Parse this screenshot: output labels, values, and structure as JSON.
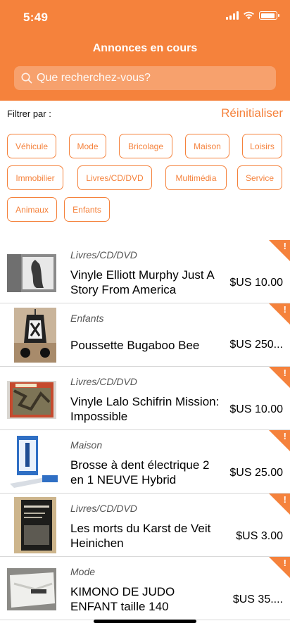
{
  "status": {
    "time": "5:49"
  },
  "header": {
    "title": "Annonces en cours"
  },
  "search": {
    "placeholder": "Que recherchez-vous?"
  },
  "filters": {
    "label": "Filtrer par :",
    "reset": "Réinitialiser",
    "chips": [
      "Véhicule",
      "Mode",
      "Bricolage",
      "Maison",
      "Loisirs",
      "Immobilier",
      "Livres/CD/DVD",
      "Multimédia",
      "Service",
      "Animaux",
      "Enfants"
    ]
  },
  "listings": [
    {
      "category": "Livres/CD/DVD",
      "title": "Vinyle Elliott Murphy Just A Story From America",
      "price": "$US 10.00",
      "image_icon": "vinyl-record-photo"
    },
    {
      "category": "Enfants",
      "title": "Poussette Bugaboo Bee",
      "price": "$US 250...",
      "image_icon": "stroller-photo"
    },
    {
      "category": "Livres/CD/DVD",
      "title": "Vinyle Lalo Schifrin Mission: Impossible",
      "price": "$US 10.00",
      "image_icon": "vinyl-record-photo"
    },
    {
      "category": "Maison",
      "title": "Brosse à dent électrique 2 en 1 NEUVE Hybrid",
      "price": "$US 25.00",
      "image_icon": "toothbrush-photo"
    },
    {
      "category": "Livres/CD/DVD",
      "title": "Les morts du Karst de Veit Heinichen",
      "price": "$US 3.00",
      "image_icon": "book-photo"
    },
    {
      "category": "Mode",
      "title": "KIMONO DE JUDO ENFANT taille 140",
      "price": "$US 35....",
      "image_icon": "kimono-photo"
    }
  ],
  "colors": {
    "accent": "#f5823c"
  },
  "flag_mark": "!"
}
